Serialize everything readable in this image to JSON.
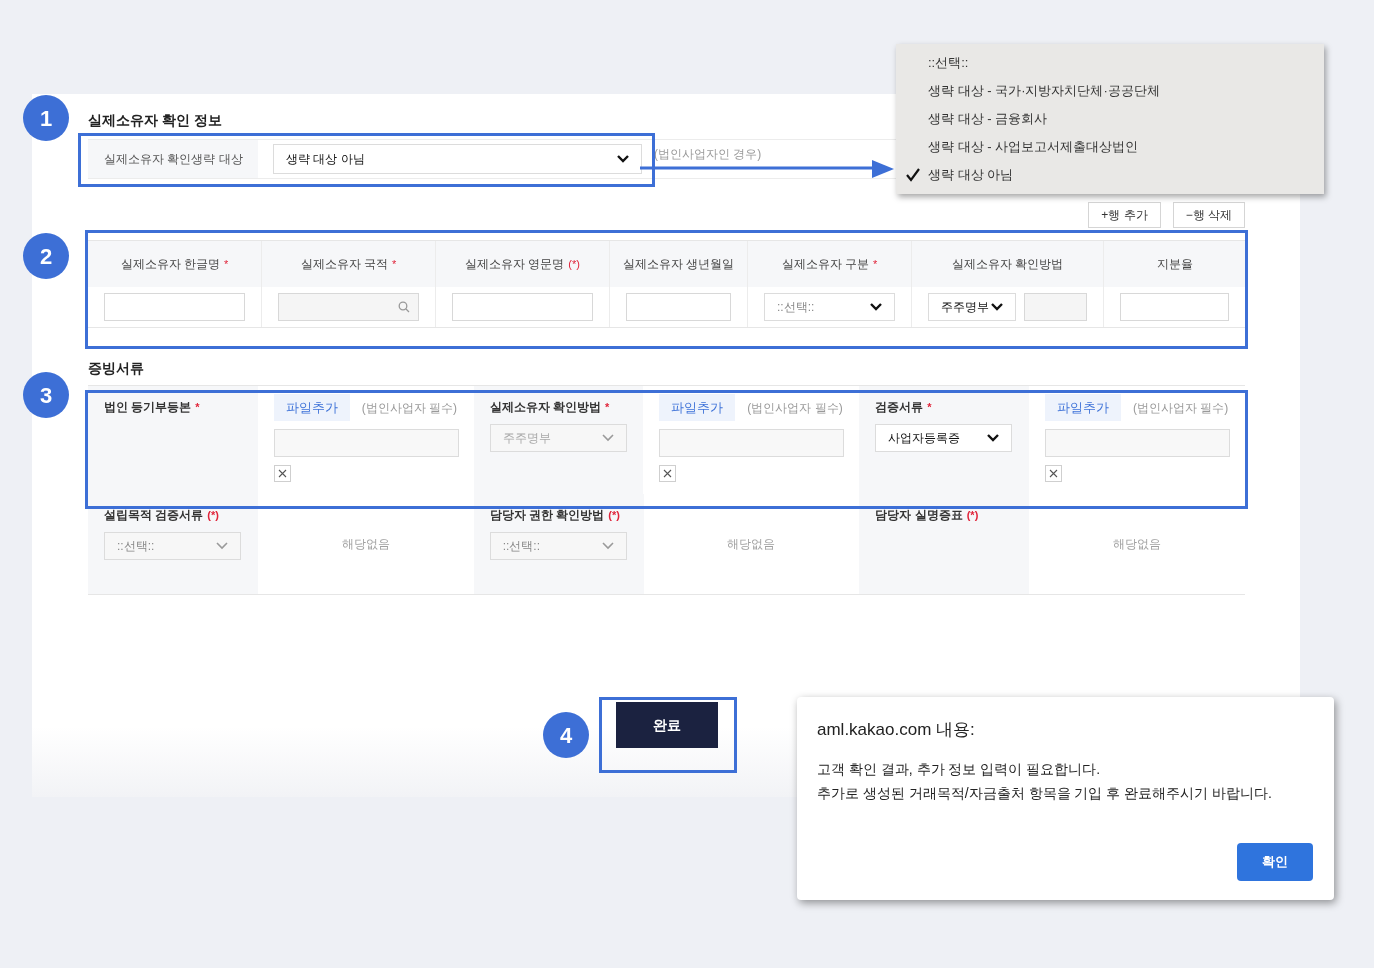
{
  "owner_section": {
    "title": "실제소유자 확인 정보",
    "label": "실제소유자 확인생략 대상",
    "select_value": "생략 대상 아님",
    "hint": "(법인사업자인 경우)"
  },
  "dropdown": {
    "options": [
      {
        "label": "::선택::",
        "selected": false
      },
      {
        "label": "생략 대상 - 국가·지방자치단체·공공단체",
        "selected": false
      },
      {
        "label": "생략 대상 - 금융회사",
        "selected": false
      },
      {
        "label": "생략 대상 - 사업보고서제출대상법인",
        "selected": false
      },
      {
        "label": "생략 대상 아님",
        "selected": true
      }
    ]
  },
  "row_buttons": [
    "+행 추가",
    "−행 삭제"
  ],
  "owner_table": {
    "columns": [
      {
        "label": "실제소유자 한글명",
        "mark": "*"
      },
      {
        "label": "실제소유자 국적",
        "mark": "*"
      },
      {
        "label": "실제소유자 영문명",
        "mark": "(*)"
      },
      {
        "label": "실제소유자 생년월일"
      },
      {
        "label": "실제소유자 구분",
        "mark": "*"
      },
      {
        "label": "실제소유자 확인방법"
      },
      {
        "label": "지분율"
      }
    ],
    "cells": [
      {
        "kind": "input"
      },
      {
        "kind": "search"
      },
      {
        "kind": "input"
      },
      {
        "kind": "input"
      },
      {
        "kind": "select",
        "placeholder": "::선택::"
      },
      {
        "kind": "select_input",
        "value": "주주명부"
      },
      {
        "kind": "input"
      }
    ]
  },
  "docs_section": {
    "title": "증빙서류",
    "rows": [
      [
        {
          "label": "법인 등기부등본",
          "mark": "*",
          "value": {
            "kind": "file",
            "button": "파일추가",
            "note": "(법인사업자 필수)"
          }
        },
        {
          "label": "실제소유자 확인방법",
          "mark": "*",
          "select": {
            "value": "주주명부",
            "disabled": true
          },
          "value": {
            "kind": "file",
            "button": "파일추가",
            "note": "(법인사업자 필수)"
          }
        },
        {
          "label": "검증서류",
          "mark": "*",
          "select": {
            "value": "사업자등록증",
            "disabled": false
          },
          "value": {
            "kind": "file",
            "button": "파일추가",
            "note": "(법인사업자 필수)"
          }
        }
      ],
      [
        {
          "label": "설립목적 검증서류",
          "mark": "(*)",
          "select": {
            "placeholder": "::선택::",
            "disabled": true
          },
          "value": {
            "kind": "text",
            "text": "해당없음"
          }
        },
        {
          "label": "담당자 권한 확인방법",
          "mark": "(*)",
          "select": {
            "placeholder": "::선택::",
            "disabled": true
          },
          "value": {
            "kind": "text",
            "text": "해당없음"
          }
        },
        {
          "label": "담당자 실명증표",
          "mark": "(*)",
          "value": {
            "kind": "text",
            "text": "해당없음"
          }
        }
      ]
    ]
  },
  "complete_button": "완료",
  "annotations": [
    "1",
    "2",
    "3",
    "4"
  ],
  "dialog": {
    "title": "aml.kakao.com 내용:",
    "lines": [
      "고객 확인 결과, 추가 정보 입력이 필요합니다.",
      "추가로 생성된 거래목적/자금출처 항목을 기입 후 완료해주시기 바랍니다."
    ],
    "button": "확인"
  }
}
